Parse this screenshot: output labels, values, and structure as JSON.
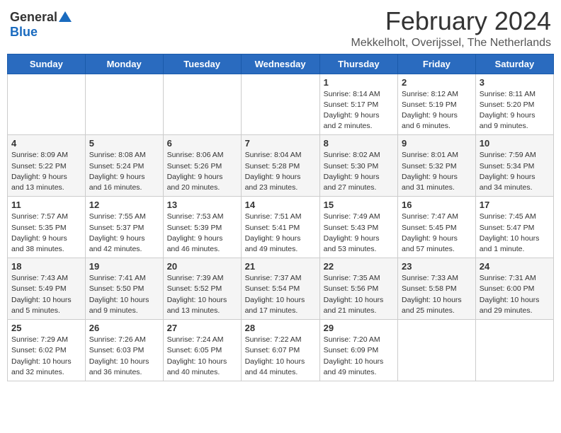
{
  "header": {
    "logo_general": "General",
    "logo_blue": "Blue",
    "month_year": "February 2024",
    "location": "Mekkelholt, Overijssel, The Netherlands"
  },
  "columns": [
    "Sunday",
    "Monday",
    "Tuesday",
    "Wednesday",
    "Thursday",
    "Friday",
    "Saturday"
  ],
  "weeks": [
    [
      {
        "day": "",
        "info": ""
      },
      {
        "day": "",
        "info": ""
      },
      {
        "day": "",
        "info": ""
      },
      {
        "day": "",
        "info": ""
      },
      {
        "day": "1",
        "info": "Sunrise: 8:14 AM\nSunset: 5:17 PM\nDaylight: 9 hours\nand 2 minutes."
      },
      {
        "day": "2",
        "info": "Sunrise: 8:12 AM\nSunset: 5:19 PM\nDaylight: 9 hours\nand 6 minutes."
      },
      {
        "day": "3",
        "info": "Sunrise: 8:11 AM\nSunset: 5:20 PM\nDaylight: 9 hours\nand 9 minutes."
      }
    ],
    [
      {
        "day": "4",
        "info": "Sunrise: 8:09 AM\nSunset: 5:22 PM\nDaylight: 9 hours\nand 13 minutes."
      },
      {
        "day": "5",
        "info": "Sunrise: 8:08 AM\nSunset: 5:24 PM\nDaylight: 9 hours\nand 16 minutes."
      },
      {
        "day": "6",
        "info": "Sunrise: 8:06 AM\nSunset: 5:26 PM\nDaylight: 9 hours\nand 20 minutes."
      },
      {
        "day": "7",
        "info": "Sunrise: 8:04 AM\nSunset: 5:28 PM\nDaylight: 9 hours\nand 23 minutes."
      },
      {
        "day": "8",
        "info": "Sunrise: 8:02 AM\nSunset: 5:30 PM\nDaylight: 9 hours\nand 27 minutes."
      },
      {
        "day": "9",
        "info": "Sunrise: 8:01 AM\nSunset: 5:32 PM\nDaylight: 9 hours\nand 31 minutes."
      },
      {
        "day": "10",
        "info": "Sunrise: 7:59 AM\nSunset: 5:34 PM\nDaylight: 9 hours\nand 34 minutes."
      }
    ],
    [
      {
        "day": "11",
        "info": "Sunrise: 7:57 AM\nSunset: 5:35 PM\nDaylight: 9 hours\nand 38 minutes."
      },
      {
        "day": "12",
        "info": "Sunrise: 7:55 AM\nSunset: 5:37 PM\nDaylight: 9 hours\nand 42 minutes."
      },
      {
        "day": "13",
        "info": "Sunrise: 7:53 AM\nSunset: 5:39 PM\nDaylight: 9 hours\nand 46 minutes."
      },
      {
        "day": "14",
        "info": "Sunrise: 7:51 AM\nSunset: 5:41 PM\nDaylight: 9 hours\nand 49 minutes."
      },
      {
        "day": "15",
        "info": "Sunrise: 7:49 AM\nSunset: 5:43 PM\nDaylight: 9 hours\nand 53 minutes."
      },
      {
        "day": "16",
        "info": "Sunrise: 7:47 AM\nSunset: 5:45 PM\nDaylight: 9 hours\nand 57 minutes."
      },
      {
        "day": "17",
        "info": "Sunrise: 7:45 AM\nSunset: 5:47 PM\nDaylight: 10 hours\nand 1 minute."
      }
    ],
    [
      {
        "day": "18",
        "info": "Sunrise: 7:43 AM\nSunset: 5:49 PM\nDaylight: 10 hours\nand 5 minutes."
      },
      {
        "day": "19",
        "info": "Sunrise: 7:41 AM\nSunset: 5:50 PM\nDaylight: 10 hours\nand 9 minutes."
      },
      {
        "day": "20",
        "info": "Sunrise: 7:39 AM\nSunset: 5:52 PM\nDaylight: 10 hours\nand 13 minutes."
      },
      {
        "day": "21",
        "info": "Sunrise: 7:37 AM\nSunset: 5:54 PM\nDaylight: 10 hours\nand 17 minutes."
      },
      {
        "day": "22",
        "info": "Sunrise: 7:35 AM\nSunset: 5:56 PM\nDaylight: 10 hours\nand 21 minutes."
      },
      {
        "day": "23",
        "info": "Sunrise: 7:33 AM\nSunset: 5:58 PM\nDaylight: 10 hours\nand 25 minutes."
      },
      {
        "day": "24",
        "info": "Sunrise: 7:31 AM\nSunset: 6:00 PM\nDaylight: 10 hours\nand 29 minutes."
      }
    ],
    [
      {
        "day": "25",
        "info": "Sunrise: 7:29 AM\nSunset: 6:02 PM\nDaylight: 10 hours\nand 32 minutes."
      },
      {
        "day": "26",
        "info": "Sunrise: 7:26 AM\nSunset: 6:03 PM\nDaylight: 10 hours\nand 36 minutes."
      },
      {
        "day": "27",
        "info": "Sunrise: 7:24 AM\nSunset: 6:05 PM\nDaylight: 10 hours\nand 40 minutes."
      },
      {
        "day": "28",
        "info": "Sunrise: 7:22 AM\nSunset: 6:07 PM\nDaylight: 10 hours\nand 44 minutes."
      },
      {
        "day": "29",
        "info": "Sunrise: 7:20 AM\nSunset: 6:09 PM\nDaylight: 10 hours\nand 49 minutes."
      },
      {
        "day": "",
        "info": ""
      },
      {
        "day": "",
        "info": ""
      }
    ]
  ]
}
